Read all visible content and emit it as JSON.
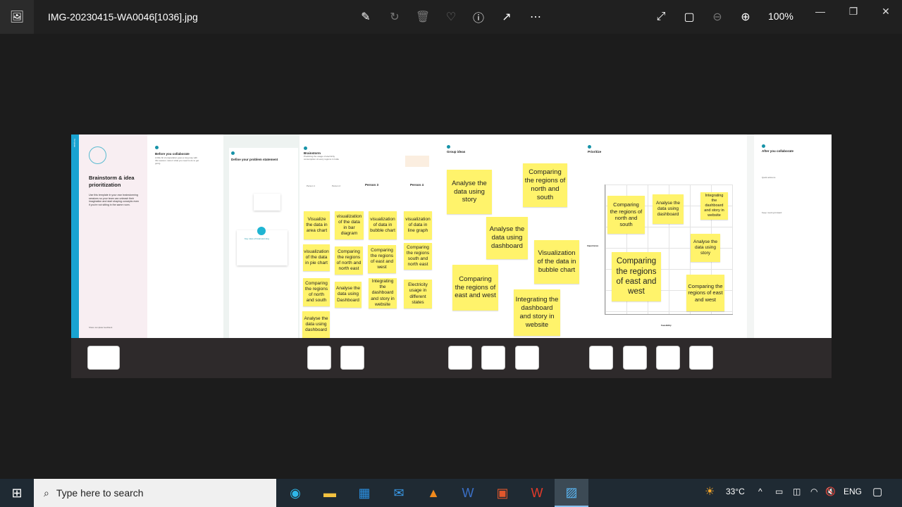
{
  "app": {
    "title": "IMG-20230415-WA0046[1036].jpg",
    "zoom": "100%"
  },
  "toolbar": {
    "edit": "edit-icon",
    "rotate": "rotate-icon",
    "delete": "delete-icon",
    "favorite": "heart-icon",
    "info": "info-icon",
    "share": "share-icon",
    "more": "⋯",
    "fullscreen": "⤢",
    "fit": "▢",
    "zoom_out": "−",
    "zoom_in": "+"
  },
  "window": {
    "minimize": "—",
    "restore": "❐",
    "close": "✕"
  },
  "board": {
    "cover": {
      "tag": "Template",
      "title": "Brainstorm & idea prioritization",
      "desc": "Use this template in your own brainstorming sessions so your team can unleash their imagination and start shaping concepts even if you're not sitting in the same room.",
      "footer": "Share template feedback"
    },
    "before": {
      "title": "Before you collaborate",
      "desc": "A little bit of preparation goes a long way with this session. Here's what you need to do to get going."
    },
    "define": {
      "title": "Define your problem statement",
      "key": "Key rules of brainstorming"
    },
    "brainstorm": {
      "title": "Brainstorm",
      "desc": "Predicting the usage of electricity consumption of every regions in India",
      "persons": [
        "Person 1",
        "Person 2",
        "Person 3",
        "Person 4"
      ],
      "notes": [
        "Visualize the data in area chart",
        "visualization of the data in bar diagram",
        "visualization of data in bubble chart",
        "visualization of data in line graph",
        "visualization of the data in pie chart",
        "Comparing the regions of north and north east",
        "Comparing the regions of east and west",
        "Comparing the regions south and north east",
        "Comparing the regions of north and south",
        "Analyse the data using Dashboard",
        "Integrating the dashboard and story in website",
        "Electricity usage in different states",
        "Analyse the data using dashboard"
      ]
    },
    "group": {
      "title": "Group ideas",
      "notes": [
        "Analyse the data using story",
        "Comparing the regions of north and south",
        "Analyse the data using dashboard",
        "Visualization of the data in bubble chart",
        "Comparing the regions of east and west",
        "Integrating the dashboard and story in website"
      ]
    },
    "prioritize": {
      "title": "Prioritize",
      "y_label": "Importance",
      "x_label": "Feasibility",
      "notes": [
        "Comparing the regions of north and south",
        "Analyse the data using dashboard",
        "Integrating the dashboard and story in website",
        "Analyse the data using story",
        "Comparing the regions of east and west",
        "Comparing the regions of east and west"
      ]
    },
    "after": {
      "title": "After you collaborate",
      "quick": "Quick add-ons",
      "keep": "Keep moving forward"
    }
  },
  "taskbar": {
    "search_placeholder": "Type here to search",
    "temp": "33°C",
    "lang": "ENG"
  }
}
